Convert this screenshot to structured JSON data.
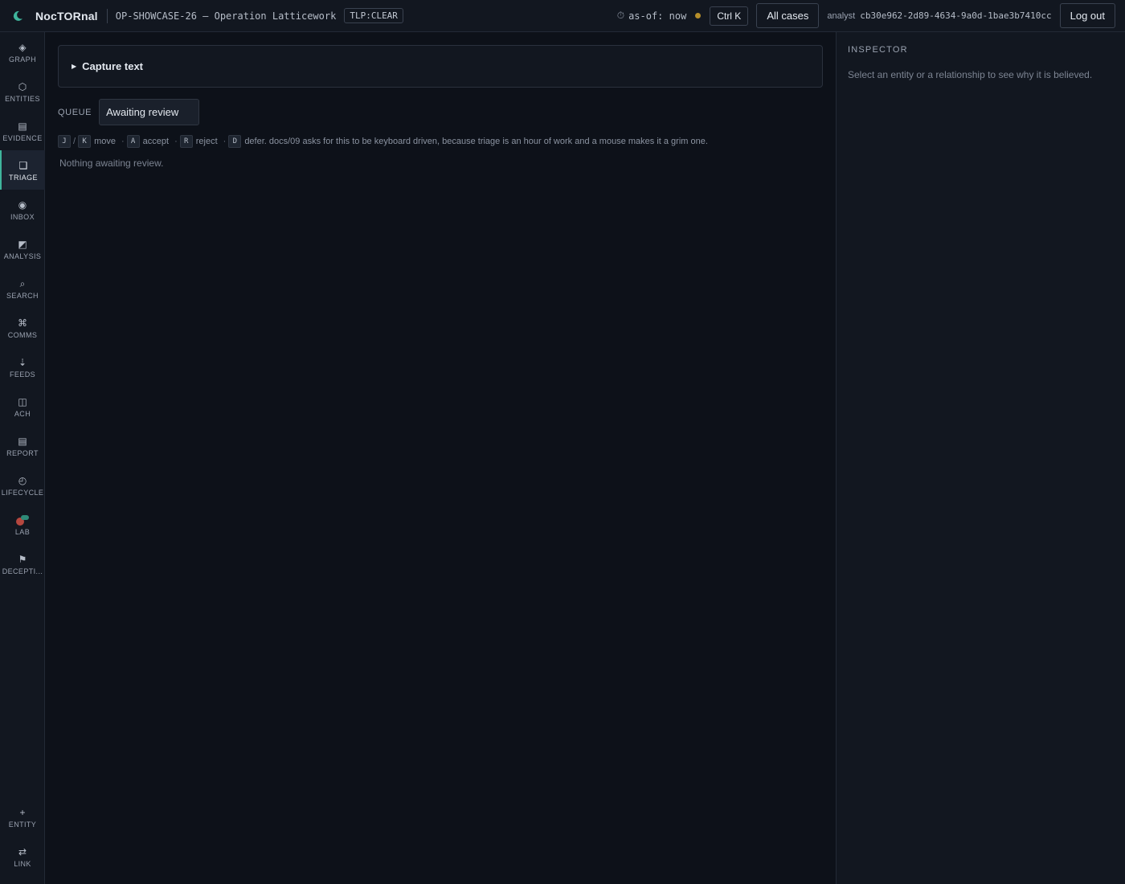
{
  "header": {
    "brand": "NocTORnal",
    "case_title": "OP-SHOWCASE-26 — Operation Latticework",
    "tlp": "TLP:CLEAR",
    "asof": "as-of: now",
    "shortcut": "Ctrl K",
    "all_cases": "All cases",
    "analyst_label": "analyst",
    "analyst_id": "cb30e962-2d89-4634-9a0d-1bae3b7410cc",
    "logout": "Log out",
    "status_color": "#b58e2a"
  },
  "sidebar": {
    "items": [
      {
        "label": "GRAPH",
        "icon": "graph-icon"
      },
      {
        "label": "ENTITIES",
        "icon": "hexagon-icon"
      },
      {
        "label": "EVIDENCE",
        "icon": "evidence-icon"
      },
      {
        "label": "TRIAGE",
        "icon": "triage-icon",
        "active": true
      },
      {
        "label": "INBOX",
        "icon": "inbox-icon"
      },
      {
        "label": "ANALYSIS",
        "icon": "analysis-icon"
      },
      {
        "label": "SEARCH",
        "icon": "search-icon"
      },
      {
        "label": "COMMS",
        "icon": "command-icon"
      },
      {
        "label": "FEEDS",
        "icon": "feeds-icon"
      },
      {
        "label": "ACH",
        "icon": "columns-icon"
      },
      {
        "label": "REPORT",
        "icon": "report-icon"
      },
      {
        "label": "LIFECYCLE",
        "icon": "clock-icon"
      },
      {
        "label": "LAB",
        "icon": "lab-icon"
      },
      {
        "label": "DECEPTI...",
        "icon": "flag-icon"
      }
    ],
    "bottom": [
      {
        "label": "ENTITY",
        "icon": "plus-icon"
      },
      {
        "label": "LINK",
        "icon": "link-icon"
      }
    ],
    "accent_color": "#3fb59c"
  },
  "main": {
    "capture_label": "Capture text",
    "queue_label": "QUEUE",
    "queue_value": "Awaiting review",
    "hints": {
      "j": "J",
      "k": "K",
      "move": "move",
      "a": "A",
      "accept": "accept",
      "r": "R",
      "reject": "reject",
      "d": "D",
      "defer": "defer. docs/09 asks for this to be keyboard driven, because triage is an hour of work and a mouse makes it a grim one."
    },
    "empty": "Nothing awaiting review."
  },
  "inspector": {
    "title": "INSPECTOR",
    "hint": "Select an entity or a relationship to see why it is believed."
  }
}
